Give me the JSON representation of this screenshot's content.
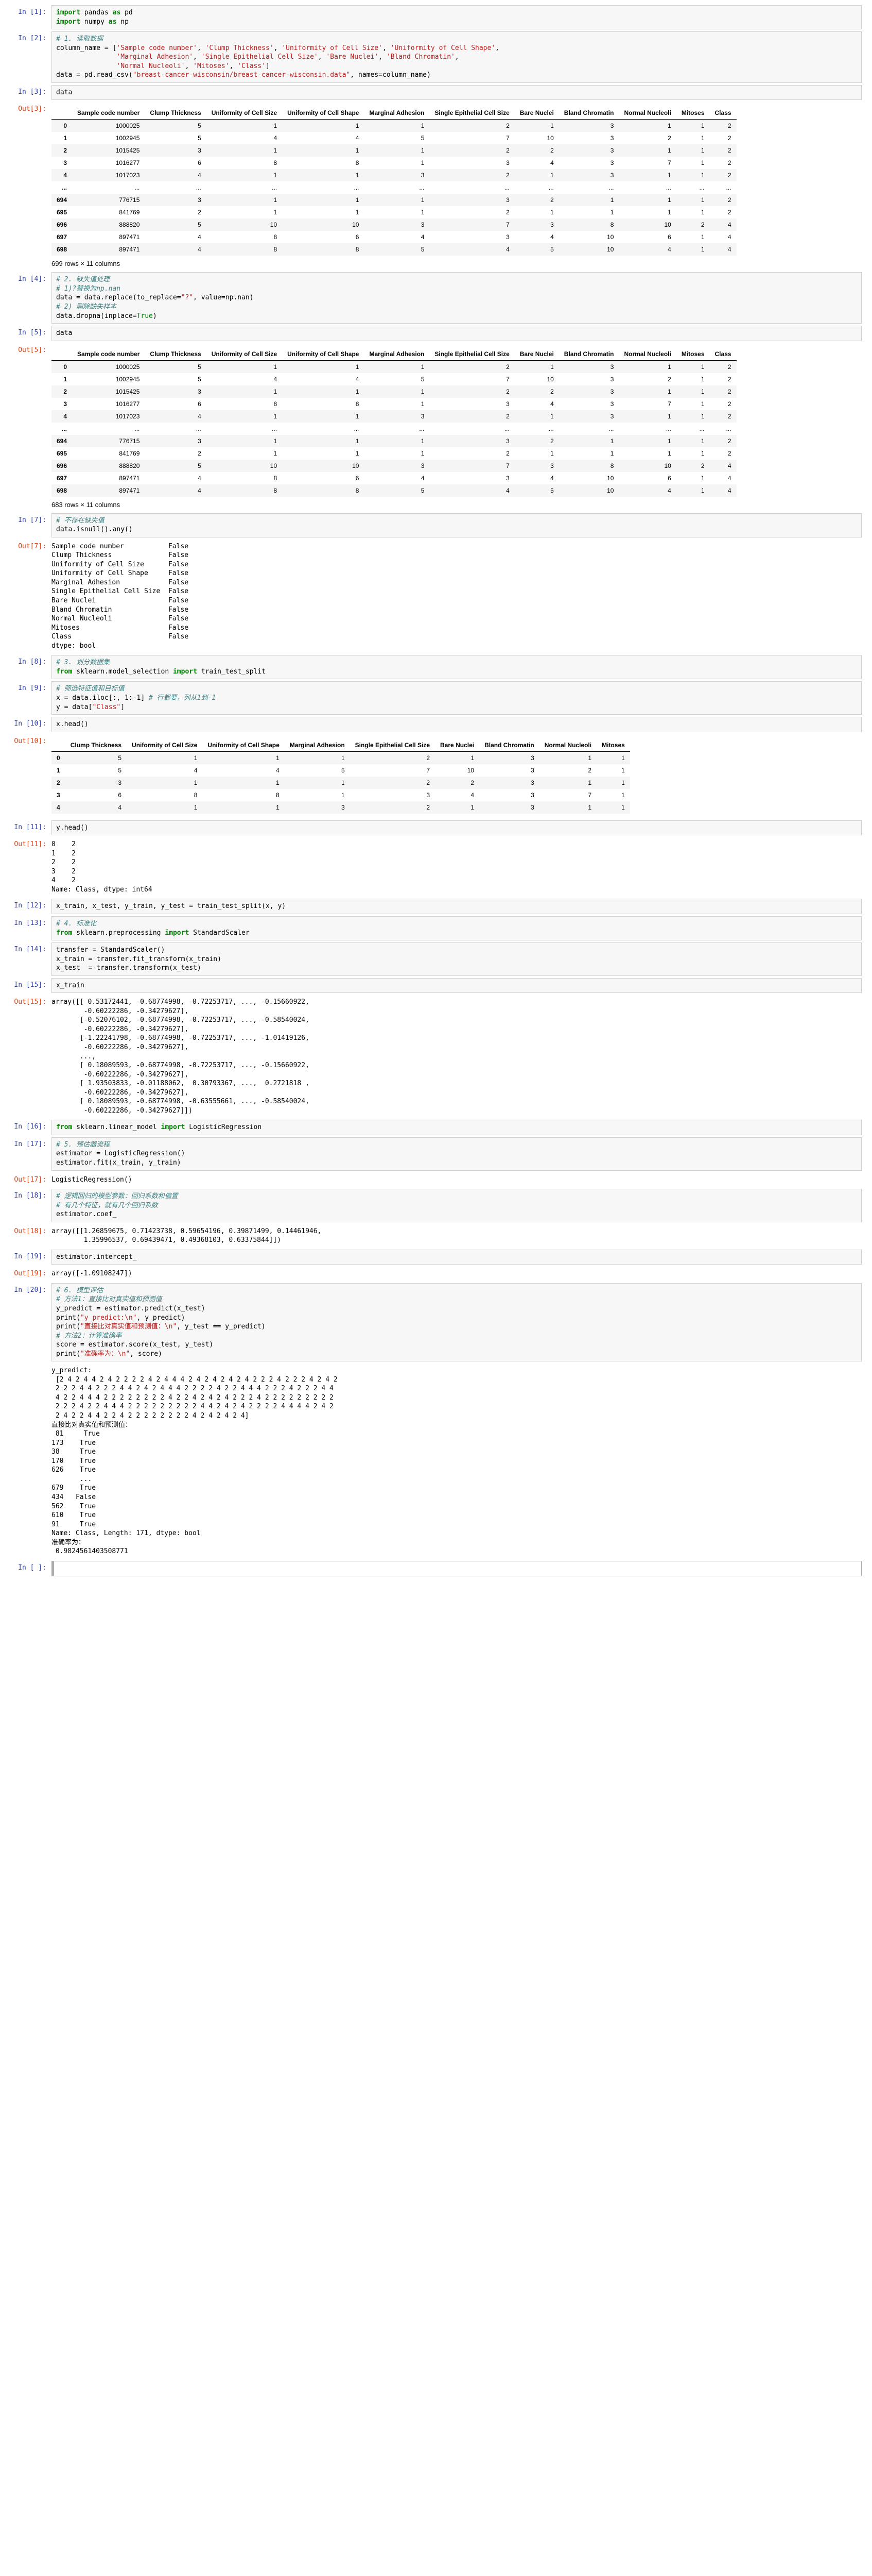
{
  "cells": [
    {
      "n": 1,
      "type": "code",
      "lines": [
        {
          "t": "<span class='kw'>import</span> pandas <span class='kw'>as</span> pd"
        },
        {
          "t": "<span class='kw'>import</span> numpy <span class='kw'>as</span> np"
        }
      ]
    },
    {
      "n": 2,
      "type": "code",
      "lines": [
        {
          "t": "<span class='cmt-it'># 1. 读取数据</span>"
        },
        {
          "t": "column_name = [<span class='str'>'Sample code number'</span>, <span class='str'>'Clump Thickness'</span>, <span class='str'>'Uniformity of Cell Size'</span>, <span class='str'>'Uniformity of Cell Shape'</span>,"
        },
        {
          "t": "               <span class='str'>'Marginal Adhesion'</span>, <span class='str'>'Single Epithelial Cell Size'</span>, <span class='str'>'Bare Nuclei'</span>, <span class='str'>'Bland Chromatin'</span>,"
        },
        {
          "t": "               <span class='str'>'Normal Nucleoli'</span>, <span class='str'>'Mitoses'</span>, <span class='str'>'Class'</span>]"
        },
        {
          "t": "data = pd.read_csv(<span class='str'>\"breast-cancer-wisconsin/breast-cancer-wisconsin.data\"</span>, names=column_name)"
        }
      ]
    },
    {
      "n": 3,
      "type": "code",
      "lines": [
        {
          "t": "data"
        }
      ],
      "output_table": "table1"
    },
    {
      "n": 4,
      "type": "code",
      "lines": [
        {
          "t": "<span class='cmt-it'># 2. 缺失值处理</span>"
        },
        {
          "t": "<span class='cmt-it'># 1)?替换为np.nan</span>"
        },
        {
          "t": "data = data.replace(to_replace=<span class='str'>\"?\"</span>, value=np.nan)"
        },
        {
          "t": "<span class='cmt-it'># 2) 删除缺失样本</span>"
        },
        {
          "t": "data.dropna(inplace=<span class='kw2'>True</span>)"
        }
      ]
    },
    {
      "n": 5,
      "type": "code",
      "lines": [
        {
          "t": "data"
        }
      ],
      "output_table": "table2"
    },
    {
      "n": 7,
      "type": "code",
      "lines": [
        {
          "t": "<span class='cmt-it'># 不存在缺失值</span>"
        },
        {
          "t": "data.isnull().any()"
        }
      ],
      "output_text": "isnull"
    },
    {
      "n": 8,
      "type": "code",
      "lines": [
        {
          "t": "<span class='cmt-it'># 3. 划分数据集</span>"
        },
        {
          "t": "<span class='kw'>from</span> sklearn.model_selection <span class='kw'>import</span> train_test_split"
        }
      ]
    },
    {
      "n": 9,
      "type": "code",
      "lines": [
        {
          "t": "<span class='cmt-it'># 筛选特征值和目标值</span>"
        },
        {
          "t": "x = data.iloc[:, 1:-1] <span class='cmt-it'># 行都要，列从1到-1</span>"
        },
        {
          "t": "y = data[<span class='str'>\"Class\"</span>]"
        }
      ]
    },
    {
      "n": 10,
      "type": "code",
      "lines": [
        {
          "t": "x.head()"
        }
      ],
      "output_table": "table3"
    },
    {
      "n": 11,
      "type": "code",
      "lines": [
        {
          "t": "y.head()"
        }
      ],
      "output_text": "yhead"
    },
    {
      "n": 12,
      "type": "code",
      "lines": [
        {
          "t": "x_train, x_test, y_train, y_test = train_test_split(x, y)"
        }
      ]
    },
    {
      "n": 13,
      "type": "code",
      "lines": [
        {
          "t": "<span class='cmt-it'># 4. 标准化</span>"
        },
        {
          "t": "<span class='kw'>from</span> sklearn.preprocessing <span class='kw'>import</span> StandardScaler"
        }
      ]
    },
    {
      "n": 14,
      "type": "code",
      "lines": [
        {
          "t": "transfer = StandardScaler()"
        },
        {
          "t": "x_train = transfer.fit_transform(x_train)"
        },
        {
          "t": "x_test  = transfer.transform(x_test)"
        }
      ]
    },
    {
      "n": 15,
      "type": "code",
      "lines": [
        {
          "t": "x_train"
        }
      ],
      "output_text": "xtrain"
    },
    {
      "n": 16,
      "type": "code",
      "lines": [
        {
          "t": "<span class='kw'>from</span> sklearn.linear_model <span class='kw'>import</span> LogisticRegression"
        }
      ]
    },
    {
      "n": 17,
      "type": "code",
      "lines": [
        {
          "t": "<span class='cmt-it'># 5. 预估器流程</span>"
        },
        {
          "t": "estimator = LogisticRegression()"
        },
        {
          "t": "estimator.fit(x_train, y_train)"
        }
      ],
      "output_text": "lr"
    },
    {
      "n": 18,
      "type": "code",
      "lines": [
        {
          "t": "<span class='cmt-it'># 逻辑回归的模型参数：回归系数和偏置</span>"
        },
        {
          "t": "<span class='cmt-it'># 有几个特征，就有几个回归系数</span>"
        },
        {
          "t": "estimator.coef_"
        }
      ],
      "output_text": "coef"
    },
    {
      "n": 19,
      "type": "code",
      "lines": [
        {
          "t": "estimator.intercept_"
        }
      ],
      "output_text": "intercept"
    },
    {
      "n": 20,
      "type": "code",
      "lines": [
        {
          "t": "<span class='cmt-it'># 6. 模型评估</span>"
        },
        {
          "t": "<span class='cmt-it'># 方法1：直接比对真实值和预测值</span>"
        },
        {
          "t": "y_predict = estimator.predict(x_test)"
        },
        {
          "t": "print(<span class='str'>\"y_predict:\\n\"</span>, y_predict)"
        },
        {
          "t": "print(<span class='str'>\"直接比对真实值和预测值：\\n\"</span>, y_test == y_predict)"
        },
        {
          "t": "<span class='cmt-it'># 方法2：计算准确率</span>"
        },
        {
          "t": "score = estimator.score(x_test, y_test)"
        },
        {
          "t": "print(<span class='str'>\"准确率为：\\n\"</span>, score)"
        }
      ],
      "output_text": "eval"
    },
    {
      "n": null,
      "type": "code",
      "lines": [
        {
          "t": ""
        }
      ],
      "active": true
    }
  ],
  "tables": {
    "table1": {
      "columns": [
        "Sample code number",
        "Clump Thickness",
        "Uniformity of Cell Size",
        "Uniformity of Cell Shape",
        "Marginal Adhesion",
        "Single Epithelial Cell Size",
        "Bare Nuclei",
        "Bland Chromatin",
        "Normal Nucleoli",
        "Mitoses",
        "Class"
      ],
      "rows": [
        [
          "0",
          "1000025",
          "5",
          "1",
          "1",
          "1",
          "2",
          "1",
          "3",
          "1",
          "1",
          "2"
        ],
        [
          "1",
          "1002945",
          "5",
          "4",
          "4",
          "5",
          "7",
          "10",
          "3",
          "2",
          "1",
          "2"
        ],
        [
          "2",
          "1015425",
          "3",
          "1",
          "1",
          "1",
          "2",
          "2",
          "3",
          "1",
          "1",
          "2"
        ],
        [
          "3",
          "1016277",
          "6",
          "8",
          "8",
          "1",
          "3",
          "4",
          "3",
          "7",
          "1",
          "2"
        ],
        [
          "4",
          "1017023",
          "4",
          "1",
          "1",
          "3",
          "2",
          "1",
          "3",
          "1",
          "1",
          "2"
        ],
        [
          "...",
          "...",
          "...",
          "...",
          "...",
          "...",
          "...",
          "...",
          "...",
          "...",
          "...",
          "..."
        ],
        [
          "694",
          "776715",
          "3",
          "1",
          "1",
          "1",
          "3",
          "2",
          "1",
          "1",
          "1",
          "2"
        ],
        [
          "695",
          "841769",
          "2",
          "1",
          "1",
          "1",
          "2",
          "1",
          "1",
          "1",
          "1",
          "2"
        ],
        [
          "696",
          "888820",
          "5",
          "10",
          "10",
          "3",
          "7",
          "3",
          "8",
          "10",
          "2",
          "4"
        ],
        [
          "697",
          "897471",
          "4",
          "8",
          "6",
          "4",
          "3",
          "4",
          "10",
          "6",
          "1",
          "4"
        ],
        [
          "698",
          "897471",
          "4",
          "8",
          "8",
          "5",
          "4",
          "5",
          "10",
          "4",
          "1",
          "4"
        ]
      ],
      "footer": "699 rows × 11 columns"
    },
    "table2": {
      "columns": [
        "Sample code number",
        "Clump Thickness",
        "Uniformity of Cell Size",
        "Uniformity of Cell Shape",
        "Marginal Adhesion",
        "Single Epithelial Cell Size",
        "Bare Nuclei",
        "Bland Chromatin",
        "Normal Nucleoli",
        "Mitoses",
        "Class"
      ],
      "rows": [
        [
          "0",
          "1000025",
          "5",
          "1",
          "1",
          "1",
          "2",
          "1",
          "3",
          "1",
          "1",
          "2"
        ],
        [
          "1",
          "1002945",
          "5",
          "4",
          "4",
          "5",
          "7",
          "10",
          "3",
          "2",
          "1",
          "2"
        ],
        [
          "2",
          "1015425",
          "3",
          "1",
          "1",
          "1",
          "2",
          "2",
          "3",
          "1",
          "1",
          "2"
        ],
        [
          "3",
          "1016277",
          "6",
          "8",
          "8",
          "1",
          "3",
          "4",
          "3",
          "7",
          "1",
          "2"
        ],
        [
          "4",
          "1017023",
          "4",
          "1",
          "1",
          "3",
          "2",
          "1",
          "3",
          "1",
          "1",
          "2"
        ],
        [
          "...",
          "...",
          "...",
          "...",
          "...",
          "...",
          "...",
          "...",
          "...",
          "...",
          "...",
          "..."
        ],
        [
          "694",
          "776715",
          "3",
          "1",
          "1",
          "1",
          "3",
          "2",
          "1",
          "1",
          "1",
          "2"
        ],
        [
          "695",
          "841769",
          "2",
          "1",
          "1",
          "1",
          "2",
          "1",
          "1",
          "1",
          "1",
          "2"
        ],
        [
          "696",
          "888820",
          "5",
          "10",
          "10",
          "3",
          "7",
          "3",
          "8",
          "10",
          "2",
          "4"
        ],
        [
          "697",
          "897471",
          "4",
          "8",
          "6",
          "4",
          "3",
          "4",
          "10",
          "6",
          "1",
          "4"
        ],
        [
          "698",
          "897471",
          "4",
          "8",
          "8",
          "5",
          "4",
          "5",
          "10",
          "4",
          "1",
          "4"
        ]
      ],
      "footer": "683 rows × 11 columns"
    },
    "table3": {
      "columns": [
        "Clump Thickness",
        "Uniformity of Cell Size",
        "Uniformity of Cell Shape",
        "Marginal Adhesion",
        "Single Epithelial Cell Size",
        "Bare Nuclei",
        "Bland Chromatin",
        "Normal Nucleoli",
        "Mitoses"
      ],
      "rows": [
        [
          "0",
          "5",
          "1",
          "1",
          "1",
          "2",
          "1",
          "3",
          "1",
          "1"
        ],
        [
          "1",
          "5",
          "4",
          "4",
          "5",
          "7",
          "10",
          "3",
          "2",
          "1"
        ],
        [
          "2",
          "3",
          "1",
          "1",
          "1",
          "2",
          "2",
          "3",
          "1",
          "1"
        ],
        [
          "3",
          "6",
          "8",
          "8",
          "1",
          "3",
          "4",
          "3",
          "7",
          "1"
        ],
        [
          "4",
          "4",
          "1",
          "1",
          "3",
          "2",
          "1",
          "3",
          "1",
          "1"
        ]
      ]
    }
  },
  "texts": {
    "isnull": "Sample code number           False\nClump Thickness              False\nUniformity of Cell Size      False\nUniformity of Cell Shape     False\nMarginal Adhesion            False\nSingle Epithelial Cell Size  False\nBare Nuclei                  False\nBland Chromatin              False\nNormal Nucleoli              False\nMitoses                      False\nClass                        False\ndtype: bool",
    "yhead": "0    2\n1    2\n2    2\n3    2\n4    2\nName: Class, dtype: int64",
    "xtrain": "array([[ 0.53172441, -0.68774998, -0.72253717, ..., -0.15660922,\n        -0.60222286, -0.34279627],\n       [-0.52076102, -0.68774998, -0.72253717, ..., -0.58540024,\n        -0.60222286, -0.34279627],\n       [-1.22241798, -0.68774998, -0.72253717, ..., -1.01419126,\n        -0.60222286, -0.34279627],\n       ...,\n       [ 0.18089593, -0.68774998, -0.72253717, ..., -0.15660922,\n        -0.60222286, -0.34279627],\n       [ 1.93503833, -0.01188062,  0.30793367, ...,  0.2721818 ,\n        -0.60222286, -0.34279627],\n       [ 0.18089593, -0.68774998, -0.63555661, ..., -0.58540024,\n        -0.60222286, -0.34279627]])",
    "lr": "LogisticRegression()",
    "coef": "array([[1.26859675, 0.71423738, 0.59654196, 0.39871499, 0.14461946,\n        1.35996537, 0.69439471, 0.49368103, 0.63375844]])",
    "intercept": "array([-1.09108247])",
    "eval": "y_predict:\n [2 4 2 4 4 2 4 2 2 2 2 4 2 4 4 4 2 4 2 4 2 4 2 4 2 2 2 4 2 2 2 4 2 4 2\n 2 2 2 4 4 2 2 2 4 4 2 4 2 4 4 4 2 2 2 2 4 2 2 4 4 4 2 2 2 4 2 2 2 4 4\n 4 2 2 4 4 4 2 2 2 2 2 2 2 2 4 2 2 4 2 4 2 4 2 2 2 4 2 2 2 2 2 2 2 2 2\n 2 2 2 4 2 2 4 4 4 2 2 2 2 2 2 2 2 2 4 4 2 4 2 4 2 2 2 2 4 4 4 4 2 4 2\n 2 4 2 2 4 4 2 2 4 2 2 2 2 2 2 2 2 4 2 4 2 4 2 4]\n直接比对真实值和预测值：\n 81     True\n173    True\n38     True\n170    True\n626    True\n       ... \n679    True\n434   False\n562    True\n610    True\n91     True\nName: Class, Length: 171, dtype: bool\n准确率为：\n 0.9824561403508771"
  }
}
